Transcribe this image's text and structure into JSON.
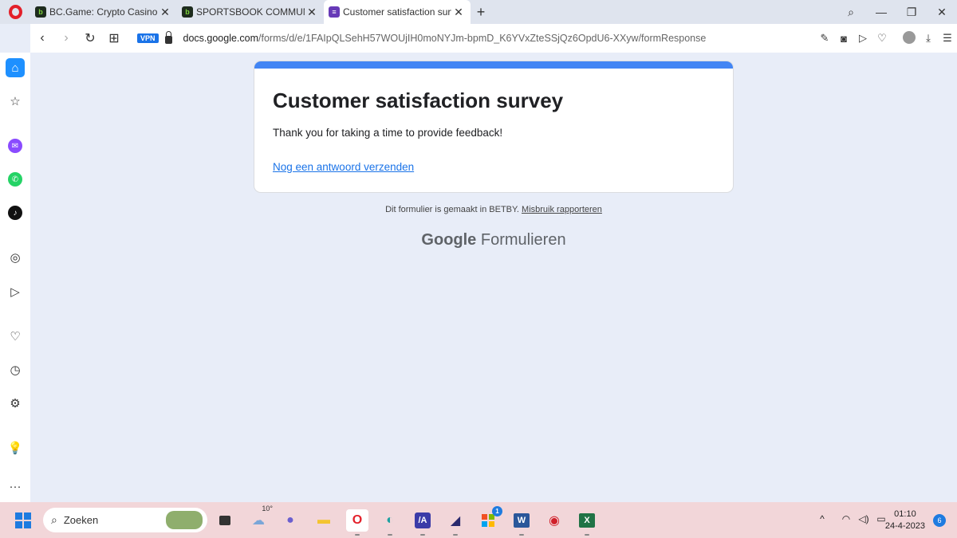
{
  "browser": {
    "tabs": [
      {
        "title": "BC.Game: Crypto Casino Ga",
        "favicon": "bc-game-icon",
        "active": false
      },
      {
        "title": "SPORTSBOOK COMMUNIT",
        "favicon": "bc-game-icon",
        "active": false
      },
      {
        "title": "Customer satisfaction surve",
        "favicon": "google-forms-icon",
        "active": true
      }
    ],
    "vpn_label": "VPN",
    "url_host": "docs.google.com",
    "url_path": "/forms/d/e/1FAIpQLSehH57WOUjIH0moNYJm-bpmD_K6YVxZteSSjQz6OpdU6-XXyw/formResponse"
  },
  "form": {
    "title": "Customer satisfaction survey",
    "message": "Thank you for taking a time to provide feedback!",
    "resubmit_link": "Nog een antwoord verzenden",
    "accent_color": "#4285f4"
  },
  "footer": {
    "note": "Dit formulier is gemaakt in BETBY.",
    "abuse_link": "Misbruik rapporteren",
    "brand_google": "Google",
    "brand_forms": "Formulieren"
  },
  "taskbar": {
    "search_placeholder": "Zoeken",
    "weather_temp": "10°",
    "store_badge": "1",
    "time": "01:10",
    "date": "24-4-2023",
    "notification_count": "6"
  }
}
